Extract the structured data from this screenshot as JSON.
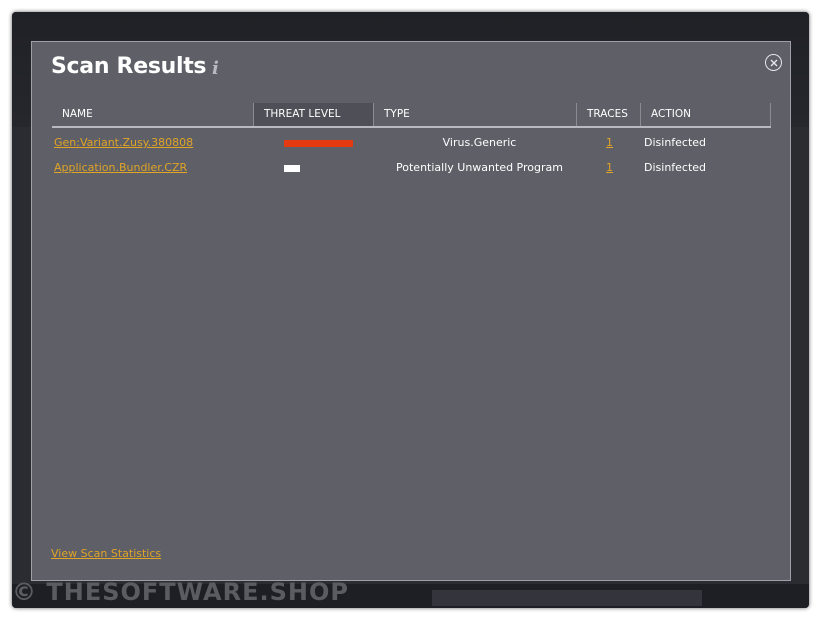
{
  "watermark": "© THESOFTWARE.SHOP",
  "dialog": {
    "title": "Scan Results",
    "info_icon": "i",
    "close_icon": "close-icon"
  },
  "table": {
    "columns": [
      "NAME",
      "THREAT LEVEL",
      "TYPE",
      "TRACES",
      "ACTION"
    ],
    "sorted_column": "THREAT LEVEL",
    "rows": [
      {
        "name": "Gen:Variant.Zusy.380808",
        "threat_level": "high",
        "type": "Virus.Generic",
        "traces": "1",
        "action": "Disinfected"
      },
      {
        "name": "Application.Bundler.CZR",
        "threat_level": "low",
        "type": "Potentially Unwanted Program",
        "traces": "1",
        "action": "Disinfected"
      }
    ]
  },
  "footer": {
    "link": "View Scan Statistics"
  },
  "colors": {
    "accent_link": "#e0a427",
    "threat_high": "#e33a12",
    "threat_low": "#ffffff",
    "dialog_bg": "#5e5f67"
  }
}
